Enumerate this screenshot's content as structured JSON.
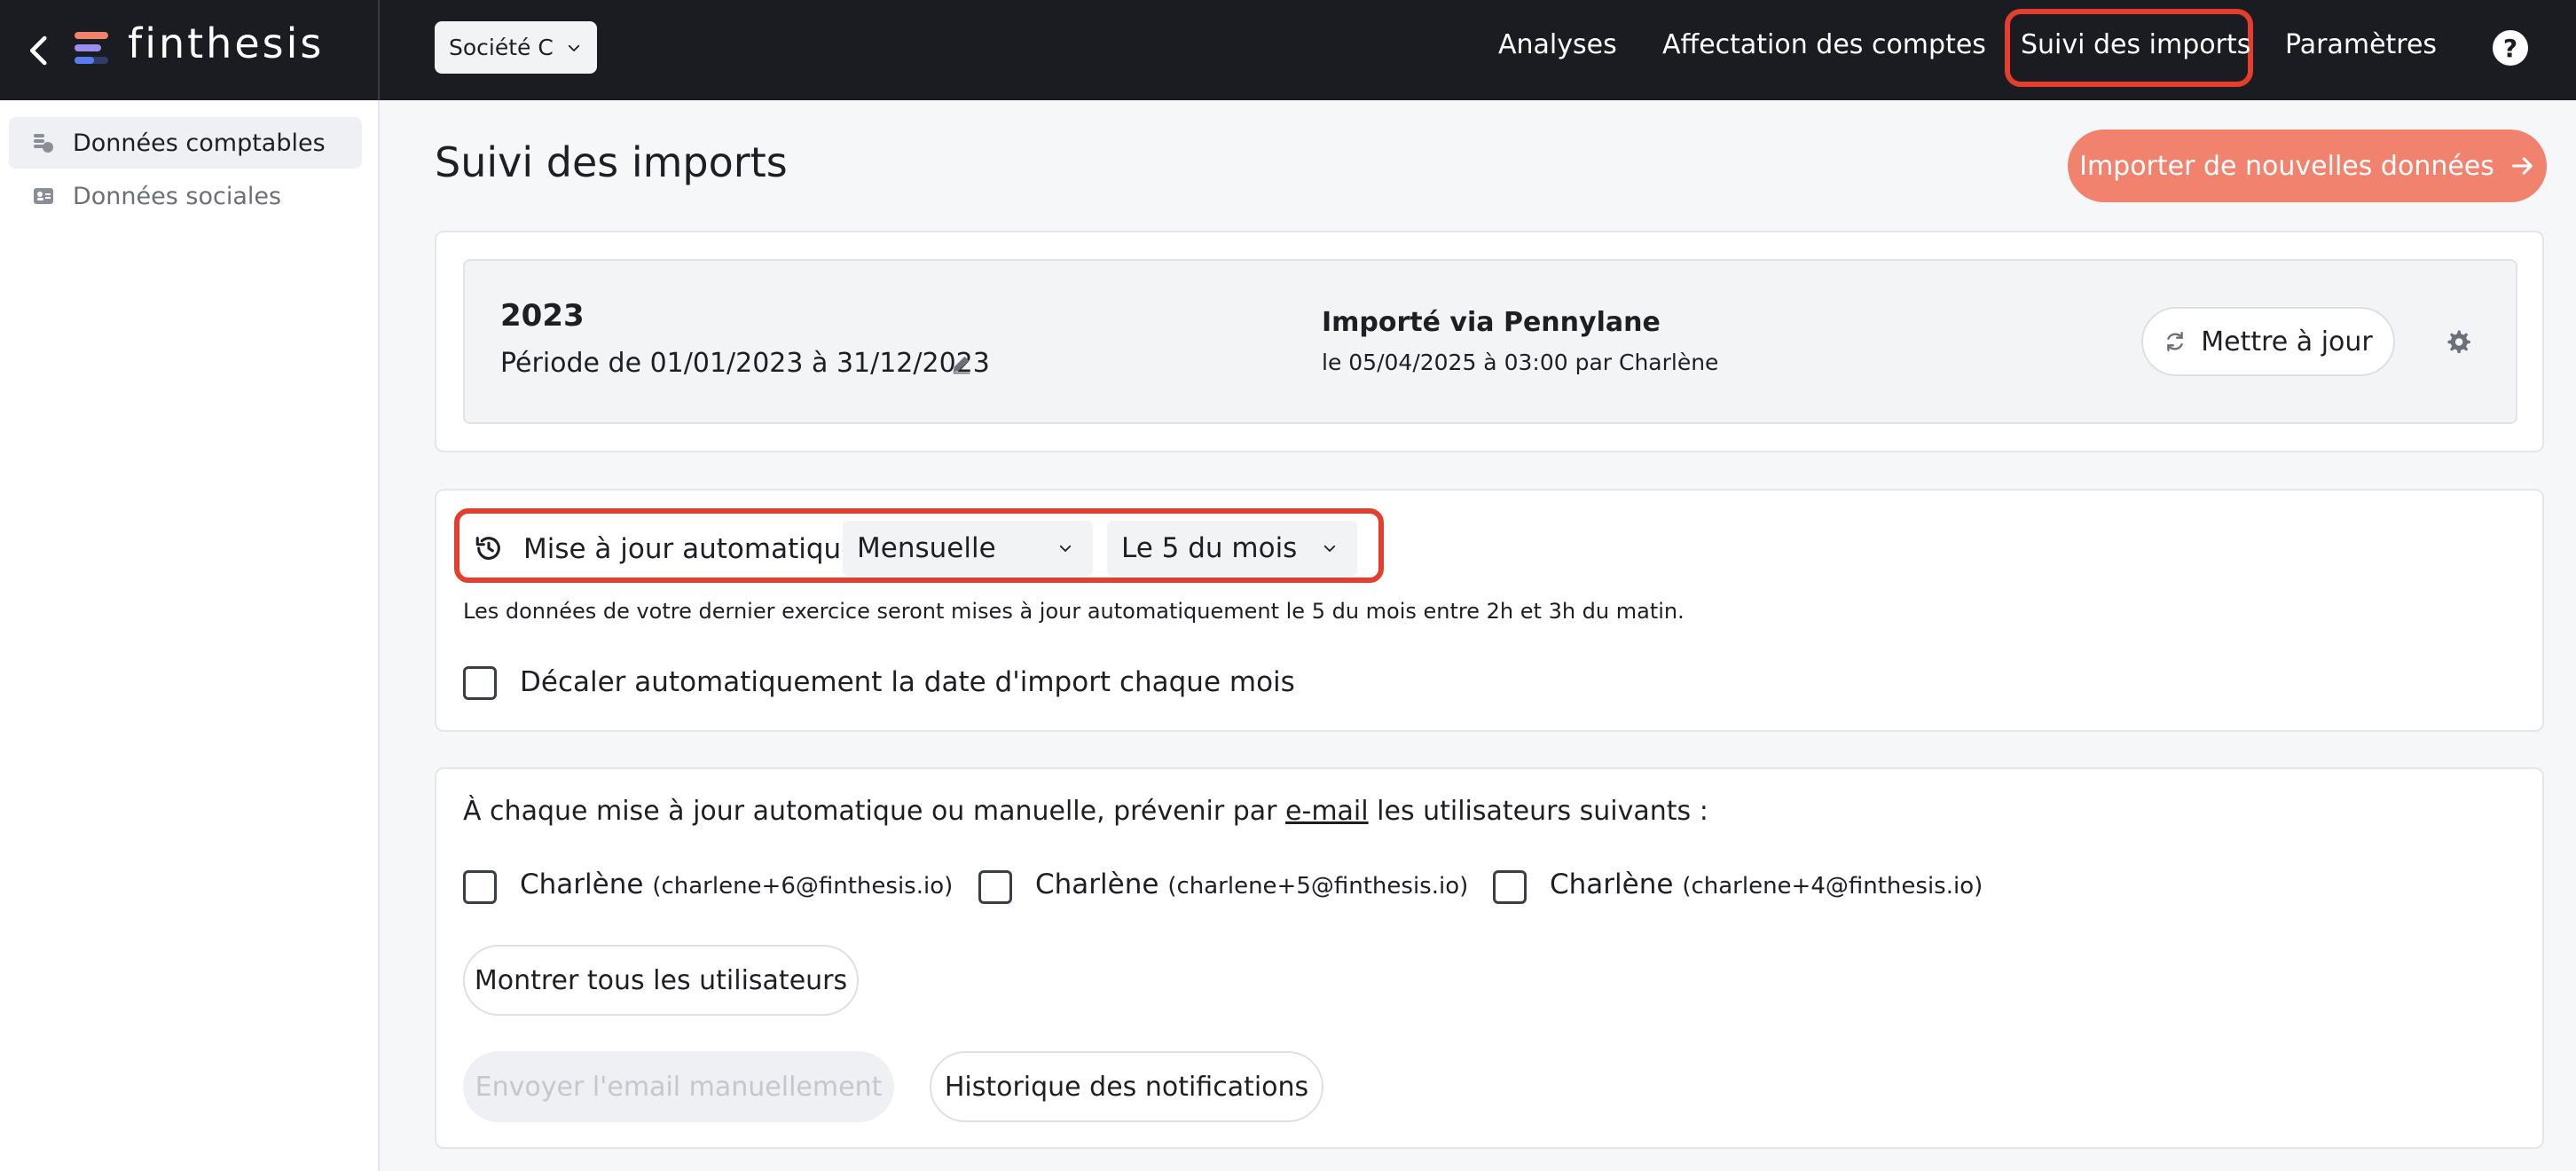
{
  "app": {
    "name": "finthesis"
  },
  "header": {
    "company": "Société C",
    "nav": {
      "analyses": "Analyses",
      "affectation": "Affectation des comptes",
      "suivi": "Suivi des imports",
      "parametres": "Paramètres"
    },
    "help": "?"
  },
  "sidebar": {
    "items": [
      {
        "label": "Données comptables",
        "active": true
      },
      {
        "label": "Données sociales",
        "active": false
      }
    ]
  },
  "main": {
    "title": "Suivi des imports",
    "import_button": "Importer de nouvelles données",
    "period": {
      "year": "2023",
      "range": "Période de 01/01/2023 à 31/12/2023",
      "source": "Importé via Pennylane",
      "imported_at": "le 05/04/2025 à 03:00 par Charlène",
      "update_button": "Mettre à jour"
    },
    "auto_update": {
      "label": "Mise à jour automatique",
      "frequency": "Mensuelle",
      "day": "Le 5 du mois",
      "description": "Les données de votre dernier exercice seront mises à jour automatiquement le 5 du mois entre 2h et 3h du matin.",
      "shift_label": "Décaler automatiquement la date d'import chaque mois"
    },
    "notifications": {
      "text_before": "À chaque mise à jour automatique ou manuelle, prévenir par ",
      "text_link": "e-mail",
      "text_after": " les utilisateurs suivants :",
      "users": [
        {
          "name": "Charlène",
          "email": "(charlene+6@finthesis.io)"
        },
        {
          "name": "Charlène",
          "email": "(charlene+5@finthesis.io)"
        },
        {
          "name": "Charlène",
          "email": "(charlene+4@finthesis.io)"
        }
      ],
      "show_all_button": "Montrer tous les utilisateurs",
      "send_email_button": "Envoyer l'email manuellement",
      "history_button": "Historique des notifications"
    }
  },
  "colors": {
    "topbar": "#1a1c22",
    "accent": "#f0826e",
    "highlight": "#e53d2e"
  }
}
